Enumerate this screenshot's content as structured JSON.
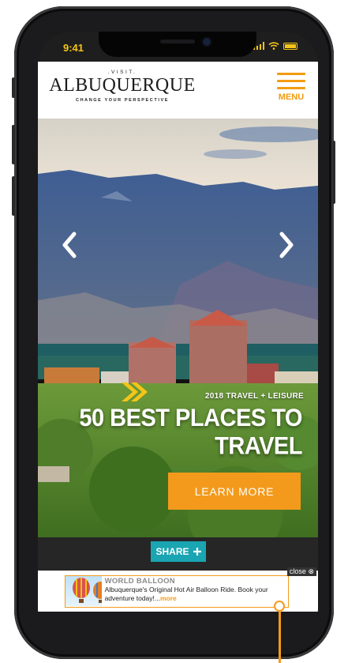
{
  "status_bar": {
    "time": "9:41",
    "icons": [
      "signal-icon",
      "wifi-icon",
      "battery-icon"
    ]
  },
  "header": {
    "logo": {
      "visit": ".VISIT.",
      "name": "ALBUQUERQUE",
      "tagline": "CHANGE YOUR PERSPECTIVE"
    },
    "menu_label": "MENU"
  },
  "hero": {
    "eyebrow": "2018 TRAVEL + LEISURE",
    "headline_line1": "50 BEST PLACES TO",
    "headline_line2": "TRAVEL",
    "cta_label": "LEARN MORE",
    "prev_icon": "chevron-left-icon",
    "next_icon": "chevron-right-icon"
  },
  "share": {
    "label": "SHARE",
    "icon": "plus-icon"
  },
  "ad": {
    "close_label": "close",
    "title": "WORLD BALLOON",
    "body": "Albuquerque's Original Hot Air Balloon Ride. Book your adventure today!...",
    "more_label": "more"
  },
  "colors": {
    "accent": "#f39a1c",
    "share": "#1aa5b2",
    "status_text": "#f5c518"
  }
}
